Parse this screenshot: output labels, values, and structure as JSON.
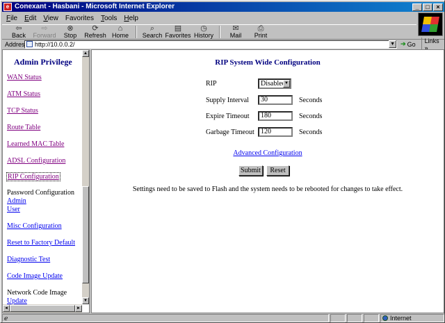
{
  "window": {
    "title": "Conexant - Hasbani - Microsoft Internet Explorer",
    "min": "_",
    "max": "□",
    "close": "×"
  },
  "menu": [
    {
      "key": "F",
      "rest": "ile"
    },
    {
      "key": "E",
      "rest": "dit"
    },
    {
      "key": "V",
      "rest": "iew"
    },
    {
      "key": "",
      "rest": "Favorites"
    },
    {
      "key": "T",
      "rest": "ools"
    },
    {
      "key": "H",
      "rest": "elp"
    }
  ],
  "toolbar": {
    "back": "Back",
    "forward": "Forward",
    "stop": "Stop",
    "refresh": "Refresh",
    "home": "Home",
    "search": "Search",
    "favorites": "Favorites",
    "history": "History",
    "mail": "Mail",
    "print": "Print"
  },
  "address": {
    "label": "Address",
    "url": "http://10.0.0.2/",
    "go": "Go",
    "links": "Links »"
  },
  "nav": {
    "title": "Admin Privilege",
    "items": [
      {
        "label": "WAN Status"
      },
      {
        "label": "ATM Status"
      },
      {
        "label": "TCP Status"
      },
      {
        "label": "Route Table"
      },
      {
        "label": "Learned MAC Table"
      },
      {
        "label": "ADSL Configuration"
      },
      {
        "label": "RIP Configuration"
      },
      {
        "label": "Password Configuration"
      },
      {
        "label": "Admin"
      },
      {
        "label": "User"
      },
      {
        "label": "Misc Configuration"
      },
      {
        "label": "Reset to Factory Default"
      },
      {
        "label": "Diagnostic Test"
      },
      {
        "label": "Code Image Update"
      },
      {
        "label": "Network Code Image"
      },
      {
        "label": "Update"
      }
    ]
  },
  "main": {
    "title": "RIP System Wide Configuration",
    "rip": {
      "label": "RIP",
      "value": "Disabled"
    },
    "supply": {
      "label": "Supply Interval",
      "value": "30",
      "unit": "Seconds"
    },
    "expire": {
      "label": "Expire Timeout",
      "value": "180",
      "unit": "Seconds"
    },
    "garbage": {
      "label": "Garbage Timeout",
      "value": "120",
      "unit": "Seconds"
    },
    "advanced": "Advanced Configuration",
    "submit": "Submit",
    "reset": "Reset",
    "note": "Settings need to be saved to Flash and the system needs to be rebooted for changes to take effect."
  },
  "status": {
    "zone": "Internet"
  }
}
